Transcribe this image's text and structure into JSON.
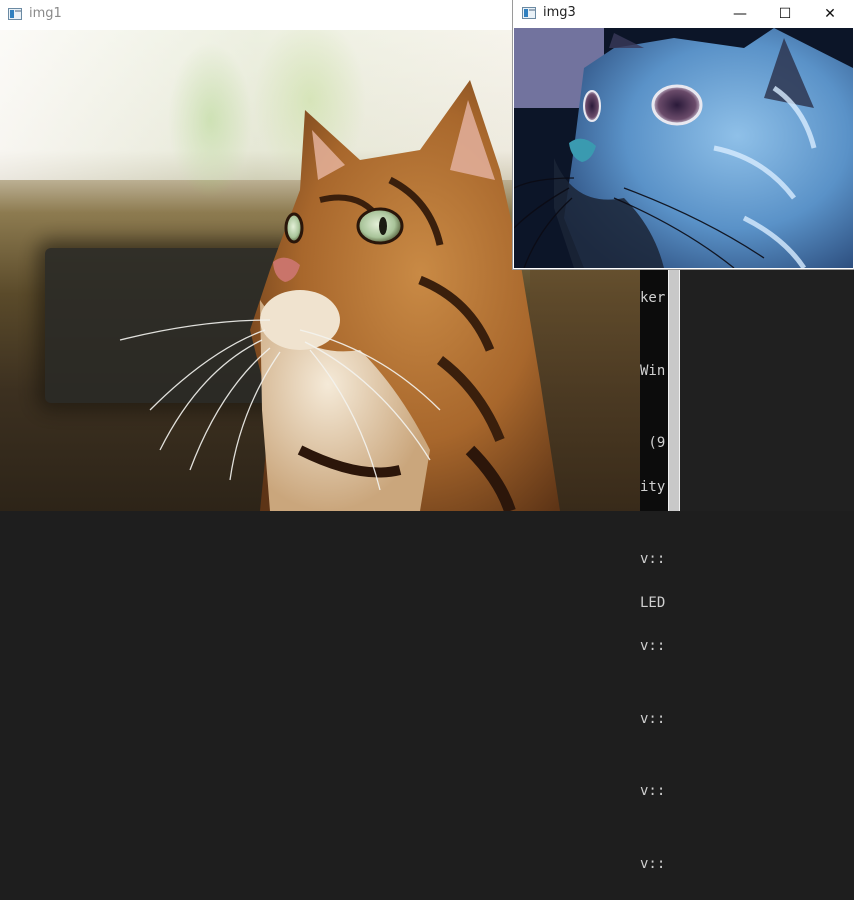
{
  "console": {
    "lines": [
      "ker",
      "",
      "Win",
      "",
      " (9",
      "ity",
      "",
      "v::",
      "LED",
      "v::",
      "",
      "v::",
      "",
      "v::",
      "",
      "v::"
    ]
  },
  "window1": {
    "title": "img1"
  },
  "window3": {
    "title": "img3",
    "controls": {
      "minimize": "—",
      "maximize": "☐",
      "close": "✕"
    }
  },
  "colors": {
    "title_inactive": "#8a8a8a",
    "title_active": "#222222"
  }
}
